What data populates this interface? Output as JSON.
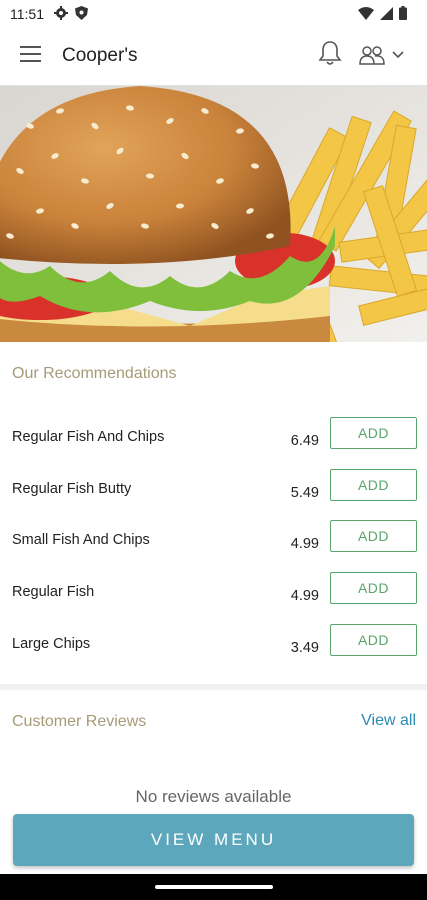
{
  "status_bar": {
    "time": "11:51",
    "icons": [
      "gear-icon",
      "shield-icon",
      "wifi-icon",
      "signal-icon",
      "battery-icon"
    ]
  },
  "app_bar": {
    "title": "Cooper's",
    "icons": [
      "menu-icon",
      "bell-icon",
      "account-icon",
      "chevron-down-icon"
    ]
  },
  "hero": {
    "image": "burger-and-fries-photo"
  },
  "recommendations": {
    "title": "Our Recommendations",
    "items": [
      {
        "name": "Regular Fish And Chips",
        "price": "6.49",
        "button": "ADD"
      },
      {
        "name": "Regular Fish Butty",
        "price": "5.49",
        "button": "ADD"
      },
      {
        "name": "Small Fish And Chips",
        "price": "4.99",
        "button": "ADD"
      },
      {
        "name": "Regular Fish",
        "price": "4.99",
        "button": "ADD"
      },
      {
        "name": "Large Chips",
        "price": "3.49",
        "button": "ADD"
      }
    ]
  },
  "reviews": {
    "title": "Customer Reviews",
    "view_all": "View all",
    "empty_text": "No reviews available"
  },
  "cta": {
    "label": "VIEW MENU"
  },
  "colors": {
    "accent_gold": "#a69b78",
    "add_green": "#5aa56c",
    "link_blue": "#2b8bb3",
    "cta_teal": "#5ca7bb"
  }
}
